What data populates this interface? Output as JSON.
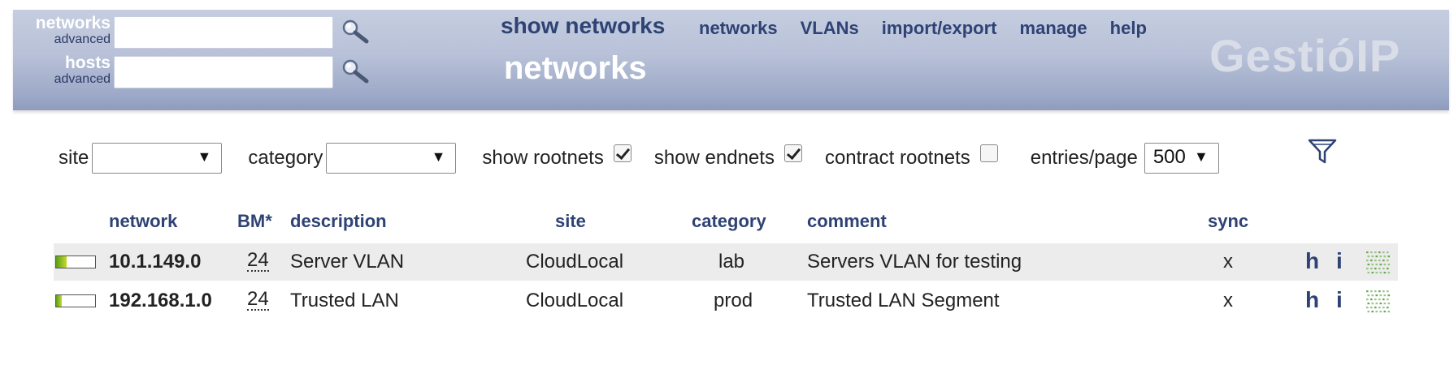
{
  "header": {
    "networks_search": {
      "label": "networks",
      "advanced": "advanced",
      "value": ""
    },
    "hosts_search": {
      "label": "hosts",
      "advanced": "advanced",
      "value": ""
    },
    "show_networks": "show networks",
    "page_heading": "networks",
    "nav": [
      "networks",
      "VLANs",
      "import/export",
      "manage",
      "help"
    ],
    "logo": "GestióIP"
  },
  "filters": {
    "site_label": "site",
    "site_value": "",
    "category_label": "category",
    "category_value": "",
    "show_rootnets_label": "show rootnets",
    "show_rootnets": true,
    "show_endnets_label": "show endnets",
    "show_endnets": true,
    "contract_rootnets_label": "contract rootnets",
    "contract_rootnets": false,
    "entries_label": "entries/page",
    "entries_value": "500"
  },
  "table": {
    "columns": [
      "network",
      "BM*",
      "description",
      "site",
      "category",
      "comment",
      "sync"
    ],
    "rows": [
      {
        "usage": 0.28,
        "network": "10.1.149.0",
        "bm": "24",
        "description": "Server VLAN",
        "site": "CloudLocal",
        "category": "lab",
        "comment": "Servers VLAN for testing",
        "sync": "x",
        "h": "h",
        "i": "i"
      },
      {
        "usage": 0.15,
        "network": "192.168.1.0",
        "bm": "24",
        "description": "Trusted LAN",
        "site": "CloudLocal",
        "category": "prod",
        "comment": "Trusted LAN Segment",
        "sync": "x",
        "h": "h",
        "i": "i"
      }
    ]
  },
  "colors": {
    "accent": "#2e4274",
    "header_bg": "#b8c1d8",
    "row_shade": "#ececec",
    "usage_fill": "#5a9e1a"
  },
  "icons": {
    "search": "magnifier-icon",
    "filter": "funnel-icon",
    "action_grid": "dotted-grid-icon"
  }
}
